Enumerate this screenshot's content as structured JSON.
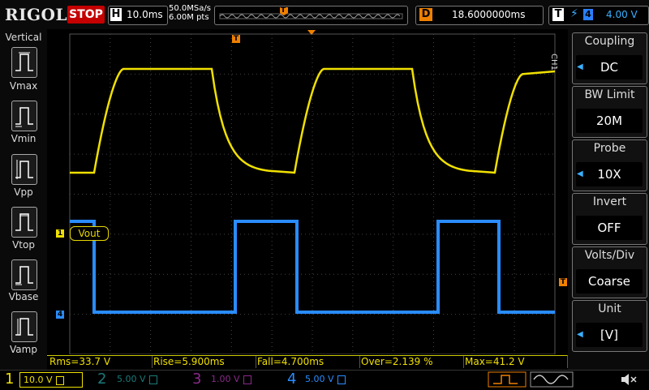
{
  "top": {
    "logo": "RIGOL",
    "run_state": "STOP",
    "timebase_key": "H",
    "timebase_value": "10.0ms",
    "sample_rate": "50.0MSa/s",
    "mem_depth": "6.00M pts",
    "trigger_marker": "T",
    "delay_key": "D",
    "delay_value": "18.6000000ms",
    "trigger_key": "T",
    "trigger_source": "4",
    "trigger_level": "4.00 V"
  },
  "vertical": {
    "title": "Vertical",
    "items": [
      {
        "label": "Vmax"
      },
      {
        "label": "Vmin"
      },
      {
        "label": "Vpp"
      },
      {
        "label": "Vtop"
      },
      {
        "label": "Vbase"
      },
      {
        "label": "Vamp"
      }
    ]
  },
  "right_menu": {
    "channel_tag": "CH1",
    "groups": [
      {
        "title": "Coupling",
        "value": "DC"
      },
      {
        "title": "BW Limit",
        "value": "20M"
      },
      {
        "title": "Probe",
        "value": "10X"
      },
      {
        "title": "Invert",
        "value": "OFF"
      },
      {
        "title": "Volts/Div",
        "value": "Coarse"
      },
      {
        "title": "Unit",
        "value": "[V]"
      }
    ]
  },
  "waveform": {
    "ch1_label": "Vout",
    "ch1_marker": "1",
    "ch4_marker": "4",
    "trigger_level_marker": "T",
    "colors": {
      "ch1": "#f0e000",
      "ch4": "#2a8cff",
      "ch2": "#22a0a0",
      "ch3": "#c040c0"
    }
  },
  "measurements": {
    "rms": "Rms=33.7 V",
    "rise": "Rise=5.900ms",
    "fall": "Fall=4.700ms",
    "over": "Over=2.139 %",
    "max": "Max=41.2 V"
  },
  "channels": [
    {
      "num": "1",
      "scale": "10.0 V"
    },
    {
      "num": "2",
      "scale": "5.00 V"
    },
    {
      "num": "3",
      "scale": "1.00 V"
    },
    {
      "num": "4",
      "scale": "5.00 V"
    }
  ],
  "icons": [
    "rising-edge-icon",
    "falling-edge-icon",
    "sine-icon",
    "speaker-mute-icon"
  ]
}
